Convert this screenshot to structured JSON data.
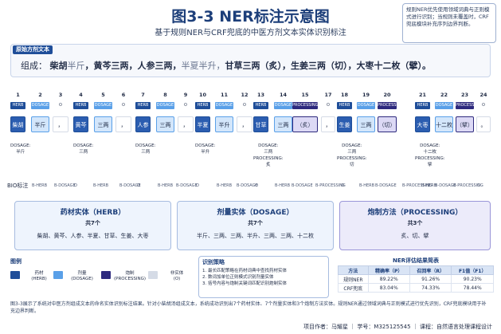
{
  "header": {
    "title": "图3-3 NER标注示意图",
    "subtitle": "基于规则NER与CRF兜底的中医方剂文本实体识别标注",
    "note": "规则NER优先使用领域词典与正则模式进行识别；当规则未覆盖时，CRF兜底模块补充序列边界判断。"
  },
  "example": {
    "label": "原始方剂文本",
    "prefix": "组成：",
    "segments": [
      {
        "text": "柴胡",
        "dim": false
      },
      {
        "text": "半斤",
        "dim": true
      },
      {
        "text": "，黄芩三两，人参三两，",
        "dim": false
      },
      {
        "text": "半夏半升，",
        "dim": true
      },
      {
        "text": "甘草三两（炙），生姜三两（切），大枣十二枚（擘）。",
        "dim": false
      }
    ]
  },
  "tokens": [
    {
      "n": "1",
      "label": "HERB",
      "type": "herb",
      "text": "柴胡"
    },
    {
      "n": "2",
      "label": "DOSAGE",
      "type": "dos",
      "text": "半斤"
    },
    {
      "n": "3",
      "label": "O",
      "type": "o",
      "text": "，"
    },
    {
      "n": "4",
      "label": "HERB",
      "type": "herb",
      "text": "黄芩"
    },
    {
      "n": "5",
      "label": "DOSAGE",
      "type": "dos",
      "text": "三两"
    },
    {
      "n": "6",
      "label": "O",
      "type": "o",
      "text": "，"
    },
    {
      "n": "7",
      "label": "HERB",
      "type": "herb",
      "text": "人参"
    },
    {
      "n": "8",
      "label": "DOSAGE",
      "type": "dos",
      "text": "三两"
    },
    {
      "n": "9",
      "label": "O",
      "type": "o",
      "text": "，"
    },
    {
      "n": "10",
      "label": "HERB",
      "type": "herb",
      "text": "半夏"
    },
    {
      "n": "11",
      "label": "DOSAGE",
      "type": "dos",
      "text": "半升"
    },
    {
      "n": "12",
      "label": "O",
      "type": "o",
      "text": "，"
    },
    {
      "n": "13",
      "label": "HERB",
      "type": "herb",
      "text": "甘草"
    },
    {
      "n": "14",
      "label": "DOSAGE",
      "type": "dos",
      "text": "三两"
    },
    {
      "n": "15",
      "label": "PROCESSING",
      "type": "proc",
      "text": "（炙）"
    },
    {
      "n": "17",
      "label": "O",
      "type": "o",
      "text": "，"
    },
    {
      "n": "18",
      "label": "HERB",
      "type": "herb",
      "text": "生姜"
    },
    {
      "n": "19",
      "label": "DOSAGE",
      "type": "dos",
      "text": "三两"
    },
    {
      "n": "20",
      "label": "PROCESSING",
      "type": "proc",
      "text": "（切）"
    },
    {
      "n": "21",
      "label": "HERB",
      "type": "herb",
      "text": "大枣"
    },
    {
      "n": "22",
      "label": "DOSAGE",
      "type": "dos",
      "text": "十二枚"
    },
    {
      "n": "23",
      "label": "PROCESSING",
      "type": "proc",
      "text": "（擘）"
    },
    {
      "n": "24",
      "label": "O",
      "type": "o",
      "text": "。"
    }
  ],
  "annotations": [
    {
      "lines": [
        "DOSAGE:",
        "半斤"
      ]
    },
    {
      "lines": [
        "DOSAGE:",
        "三两"
      ]
    },
    {
      "lines": [
        "DOSAGE:",
        "三两"
      ]
    },
    {
      "lines": [
        "DOSAGE:",
        "半升"
      ]
    },
    {
      "lines": [
        "DOSAGE:",
        "三两",
        "PROCESSING:",
        "炙"
      ]
    },
    {
      "lines": [
        "DOSAGE:",
        "三两",
        "PROCESSING:",
        "切"
      ]
    },
    {
      "lines": [
        "DOSAGE:",
        "十二枚",
        "PROCESSING:",
        "擘"
      ]
    }
  ],
  "bio": {
    "label": "BIO标注",
    "tags": [
      "B-HERB",
      "B-DOSAGE",
      "O",
      "B-HERB",
      "B-DOSAGE",
      "O",
      "B-HERB",
      "B-DOSAGE",
      "O",
      "B-HERB",
      "B-DOSAGE",
      "O",
      "B-HERB",
      "B-DOSAGE",
      "B-PROCESSING",
      "O",
      "B-HERB",
      "B-DOSAGE",
      "B-PROCESSING",
      "B-HERB",
      "B-DOSAGE",
      "B-PROCESSING",
      "O"
    ]
  },
  "entities": [
    {
      "title": "药材实体（HERB）",
      "count": "共7个",
      "items": "柴胡、黄芩、人参、半夏、甘草、生姜、大枣"
    },
    {
      "title": "剂量实体（DOSAGE）",
      "count": "共7个",
      "items": "半斤、三两、三两、半升、三两、三两、十二枚"
    },
    {
      "title": "炮制方法（PROCESSING）",
      "count": "共3个",
      "items": "炙、切、擘"
    }
  ],
  "legend": {
    "title": "图例",
    "items": [
      {
        "name": "药材",
        "sub": "(HERB)",
        "color": "#1f4e99"
      },
      {
        "name": "剂量",
        "sub": "(DOSAGE)",
        "color": "#5aa0e8"
      },
      {
        "name": "炮制",
        "sub": "(PROCESSING)",
        "color": "#2e2a7e"
      },
      {
        "name": "非实体",
        "sub": "(O)",
        "color": "#d5dbe6"
      }
    ]
  },
  "strategy": {
    "title": "识别策略",
    "items": [
      "1. 最长匹配策略在药材词典中查找药材实体",
      "2. 数词加单位正则模式识别剂量实体",
      "3. 括号内容与炮制关键词匹配识别炮制实体"
    ]
  },
  "evaluation": {
    "title": "NER评估结果简表",
    "headers": [
      "方法",
      "精确率（P）",
      "召回率（R）",
      "F1值（F1）"
    ],
    "rows": [
      [
        "规则NER",
        "89.22%",
        "91.26%",
        "90.23%"
      ],
      [
        "CRF兜底",
        "83.04%",
        "74.33%",
        "78.44%"
      ]
    ]
  },
  "caption": "图3-3展示了系统对中医方剂组成文本的命名实体识别标注结果。针对小柴胡汤组成文本，系统成功识别出7个药材实体、7个剂量实体和3个炮制方法实体。规则NER通过领域词典与正则模式进行优先识别，CRF兜底模块用于补充边界判断。",
  "footer": "项目作者：马耀星 ｜ 学号：M325125545 ｜ 课程：自然语言处理课程设计",
  "colors": {
    "herb": "#1f4e99",
    "dosage": "#5aa0e8",
    "processing": "#2e2a7e"
  }
}
